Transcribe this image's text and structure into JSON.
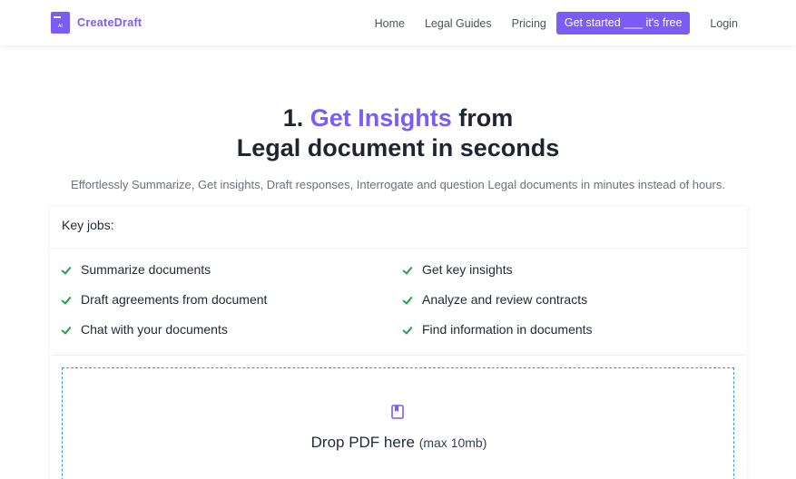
{
  "header": {
    "logo_text": "CreateDraft",
    "nav": {
      "home": "Home",
      "legal_guides": "Legal Guides",
      "pricing": "Pricing",
      "cta": "Get started ___ it's free",
      "login": "Login"
    }
  },
  "hero": {
    "title_prefix": "1. ",
    "title_accent": "Get Insights",
    "title_suffix": " from",
    "title_line2": "Legal document in seconds",
    "subtitle": "Effortlessly Summarize, Get insights, Draft responses, Interrogate and question Legal documents in minutes instead of hours."
  },
  "key_jobs": {
    "heading": "Key jobs:",
    "items": [
      "Summarize documents",
      "Get key insights",
      "Draft agreements from document",
      "Analyze and review contracts",
      "Chat with your documents",
      "Find information in documents"
    ]
  },
  "upload": {
    "icon": "book-icon",
    "label": "Drop PDF here",
    "limit": "(max 10mb)"
  },
  "colors": {
    "accent": "#7c5cf6",
    "check": "#22a04b",
    "dashed_border": "#3b96d6"
  }
}
